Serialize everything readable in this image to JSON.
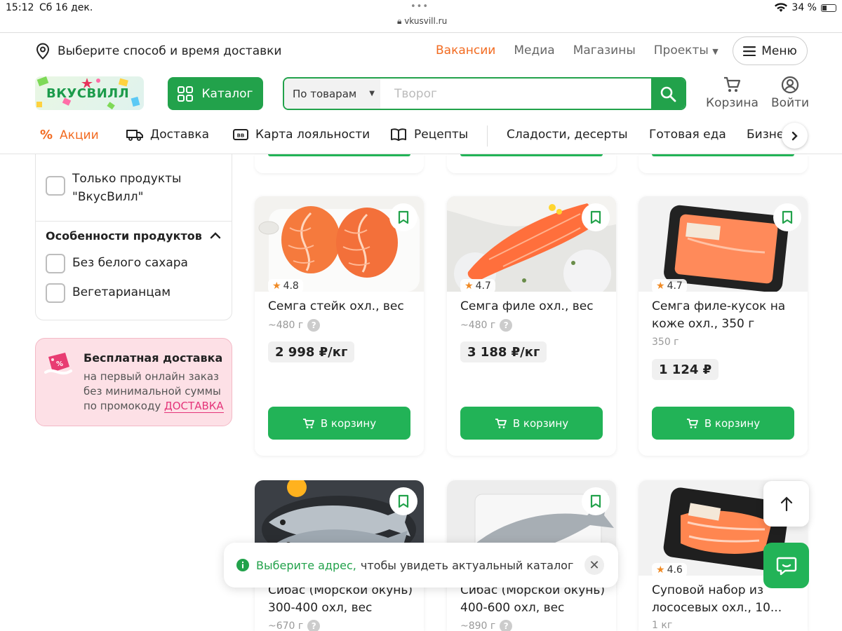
{
  "status_bar": {
    "time": "15:12",
    "date": "Сб 16 дек.",
    "url": "vkusvill.ru",
    "battery": "34 %"
  },
  "topbar": {
    "delivery_prompt": "Выберите способ и время доставки",
    "links": [
      "Вакансии",
      "Медиа",
      "Магазины",
      "Проекты"
    ],
    "menu_label": "Меню"
  },
  "header": {
    "logo_text": "ВКУСВИЛЛ",
    "catalog_label": "Каталог",
    "search_scope": "По товарам",
    "search_placeholder": "Творог",
    "cart_label": "Корзина",
    "login_label": "Войти"
  },
  "nav": {
    "items": [
      "Акции",
      "Доставка",
      "Карта лояльности",
      "Рецепты",
      "Сладости, десерты",
      "Готовая еда",
      "Бизне"
    ],
    "accent_color": "#f26b21"
  },
  "filters": {
    "only_own_label": "Только продукты \"ВкусВилл\"",
    "features_title": "Особенности продуктов",
    "options": [
      "Без белого сахара",
      "Вегетарианцам"
    ]
  },
  "promo": {
    "title": "Бесплатная доставка",
    "text": "на первый онлайн заказ без минимальной суммы по промокоду",
    "code": "ДОСТАВКА"
  },
  "products": [
    {
      "name": "Семга стейк охл., вес",
      "rating": "4.8",
      "weight": "~480 г",
      "price": "2 998 ₽/кг",
      "buy": "В корзину"
    },
    {
      "name": "Семга филе охл., вес",
      "rating": "4.7",
      "weight": "~480 г",
      "price": "3 188 ₽/кг",
      "buy": "В корзину"
    },
    {
      "name": "Семга филе-кусок на коже охл., 350 г",
      "rating": "4.7",
      "weight": "350 г",
      "price": "1 124 ₽",
      "buy": "В корзину"
    },
    {
      "name": "Сибас (Морской окунь) 300-400 охл, вес",
      "rating": "",
      "weight": "~670 г"
    },
    {
      "name": "Сибас (Морской окунь) 400-600 охл, вес",
      "rating": "",
      "weight": "~890 г"
    },
    {
      "name": "Суповой набор из лососевых охл., 10...",
      "rating": "4.6",
      "weight": "1 кг"
    }
  ],
  "toast": {
    "highlight": "Выберите адрес,",
    "text": "чтобы увидеть актуальный каталог"
  },
  "colors": {
    "brand_green": "#22a24b",
    "button_green": "#22b357",
    "orange": "#f26b21",
    "promo_pink": "#e4357a"
  }
}
